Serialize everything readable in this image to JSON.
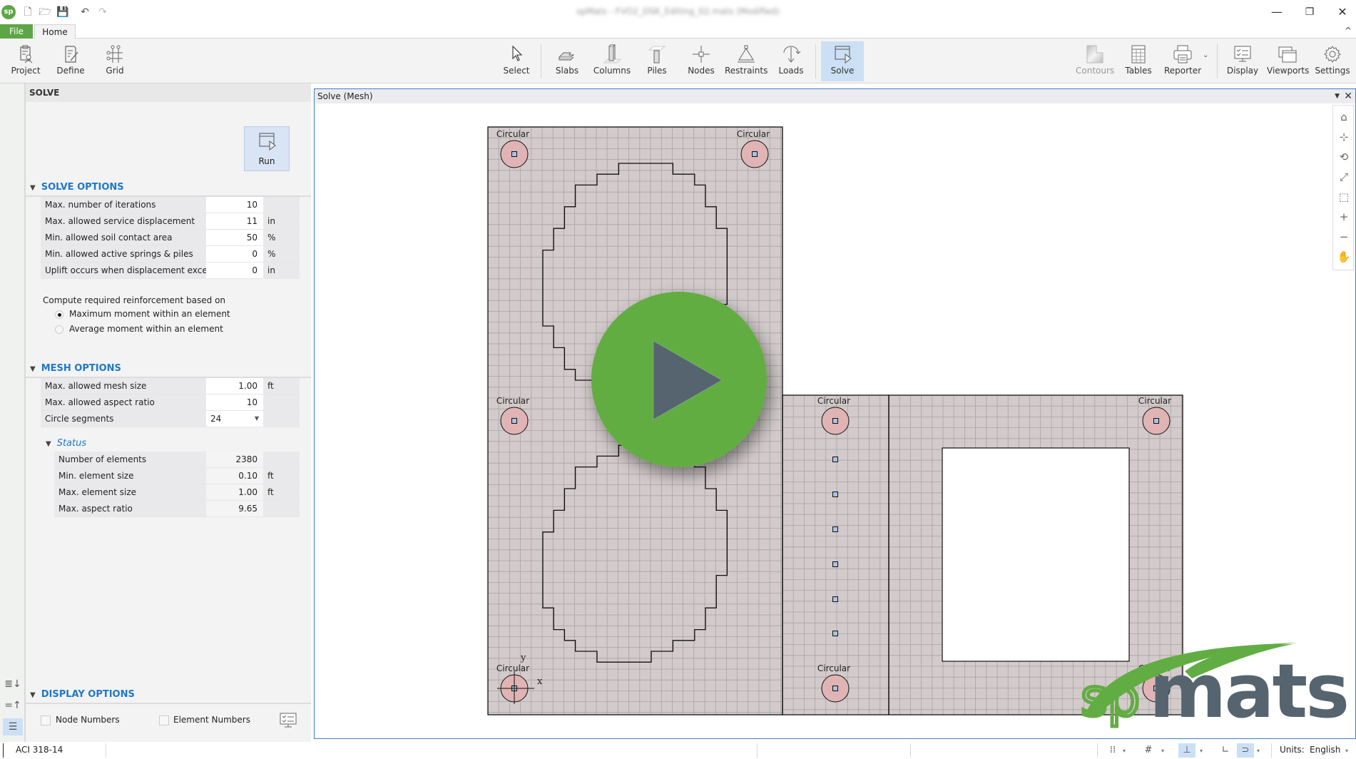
{
  "titlebar": {
    "app_logo": "sp",
    "title": "spMats - FVO2_DSK_Editing_02.mats (Modified)",
    "quick_access": [
      {
        "name": "new-file-icon",
        "glyph": "🗋"
      },
      {
        "name": "open-folder-icon",
        "glyph": "🗁"
      },
      {
        "name": "save-icon",
        "glyph": "💾"
      },
      {
        "name": "undo-icon",
        "glyph": "↶"
      },
      {
        "name": "redo-icon",
        "glyph": "↷"
      }
    ],
    "window_controls": {
      "minimize": "—",
      "restore": "❐",
      "close": "✕"
    }
  },
  "tabs": {
    "file": "File",
    "home": "Home",
    "collapse_glyph": "^"
  },
  "ribbon": {
    "left_buttons": [
      {
        "label": "Project",
        "icon": "project-icon"
      },
      {
        "label": "Define",
        "icon": "define-icon"
      },
      {
        "label": "Grid",
        "icon": "grid-icon"
      }
    ],
    "center_buttons": [
      {
        "label": "Select",
        "icon": "select-cursor-icon"
      },
      {
        "label": "Slabs",
        "icon": "slabs-icon"
      },
      {
        "label": "Columns",
        "icon": "columns-icon"
      },
      {
        "label": "Piles",
        "icon": "piles-icon"
      },
      {
        "label": "Nodes",
        "icon": "nodes-icon"
      },
      {
        "label": "Restraints",
        "icon": "restraints-icon"
      },
      {
        "label": "Loads",
        "icon": "loads-icon"
      },
      {
        "label": "Solve",
        "icon": "solve-icon",
        "active": true
      }
    ],
    "right_buttons": [
      {
        "label": "Contours",
        "icon": "contours-icon",
        "disabled": true
      },
      {
        "label": "Tables",
        "icon": "tables-icon"
      },
      {
        "label": "Reporter",
        "icon": "reporter-printer-icon"
      },
      {
        "label": "Display",
        "icon": "display-icon"
      },
      {
        "label": "Viewports",
        "icon": "viewports-icon"
      },
      {
        "label": "Settings",
        "icon": "settings-gear-icon"
      }
    ]
  },
  "left_strip": {
    "buttons": [
      "expand-all-icon",
      "collapse-all-icon",
      "list-view-icon"
    ]
  },
  "panel": {
    "header": "SOLVE",
    "run_label": "Run",
    "solve_options": {
      "title": "SOLVE OPTIONS",
      "rows": [
        {
          "label": "Max. number of iterations",
          "value": "10",
          "unit": ""
        },
        {
          "label": "Max. allowed service displacement",
          "value": "11",
          "unit": "in"
        },
        {
          "label": "Min. allowed soil contact area",
          "value": "50",
          "unit": "%"
        },
        {
          "label": "Min. allowed active springs & piles",
          "value": "0",
          "unit": "%"
        },
        {
          "label": "Uplift occurs when displacement exceeds",
          "value": "0",
          "unit": "in"
        }
      ],
      "reinforcement_label": "Compute required reinforcement based on",
      "radio_options": [
        {
          "label": "Maximum moment within an element",
          "selected": true
        },
        {
          "label": "Average moment within an element",
          "selected": false
        }
      ]
    },
    "mesh_options": {
      "title": "MESH OPTIONS",
      "rows": [
        {
          "label": "Max. allowed mesh size",
          "value": "1.00",
          "unit": "ft"
        },
        {
          "label": "Max. allowed aspect ratio",
          "value": "10",
          "unit": ""
        }
      ],
      "circle_segments": {
        "label": "Circle segments",
        "value": "24"
      }
    },
    "status": {
      "title": "Status",
      "rows": [
        {
          "label": "Number of elements",
          "value": "2380",
          "unit": ""
        },
        {
          "label": "Min. element size",
          "value": "0.10",
          "unit": "ft"
        },
        {
          "label": "Max. element size",
          "value": "1.00",
          "unit": "ft"
        },
        {
          "label": "Max. aspect ratio",
          "value": "9.65",
          "unit": ""
        }
      ]
    },
    "display_options": {
      "title": "DISPLAY OPTIONS",
      "node_numbers": {
        "label": "Node Numbers",
        "checked": false
      },
      "element_numbers": {
        "label": "Element Numbers",
        "checked": false
      }
    }
  },
  "viewport": {
    "title": "Solve (Mesh)",
    "menu_glyph": "▼",
    "close_glyph": "✕",
    "nav_tools": [
      {
        "name": "home-view-icon",
        "glyph": "⌂"
      },
      {
        "name": "axes-view-icon",
        "glyph": "⊹"
      },
      {
        "name": "rotate-icon",
        "glyph": "⟲"
      },
      {
        "name": "zoom-extents-icon",
        "glyph": "⤢"
      },
      {
        "name": "zoom-window-icon",
        "glyph": "⬚"
      },
      {
        "name": "zoom-in-icon",
        "glyph": "+"
      },
      {
        "name": "zoom-out-icon",
        "glyph": "−"
      },
      {
        "name": "pan-hand-icon",
        "glyph": "✋"
      }
    ],
    "column_label": "Circular",
    "axis_labels": {
      "x": "x",
      "y": "y"
    },
    "colors": {
      "slab_fill": "#d3cbcb",
      "mesh_line": "#a9a3a3",
      "column_fill": "#e0b3b5",
      "node_fill": "#a9c4e4",
      "play_green": "#62ad43",
      "play_triangle": "#56646f"
    },
    "logo": {
      "prefix": "sp",
      "suffix": "mats"
    }
  },
  "statusbar": {
    "code": "ACI 318-14",
    "tools": [
      {
        "name": "snap-points-icon",
        "glyph": "⁞⁞",
        "active": false
      },
      {
        "name": "snap-grid-icon",
        "glyph": "#",
        "active": false
      },
      {
        "name": "snap-node-icon",
        "glyph": "⊥",
        "active": true
      },
      {
        "name": "ortho-icon",
        "glyph": "∟",
        "active": false
      },
      {
        "name": "magnet-icon",
        "glyph": "⊃",
        "active": true
      }
    ],
    "dropdown_glyph": "▾",
    "units_label": "Units:",
    "units_value": "English"
  }
}
